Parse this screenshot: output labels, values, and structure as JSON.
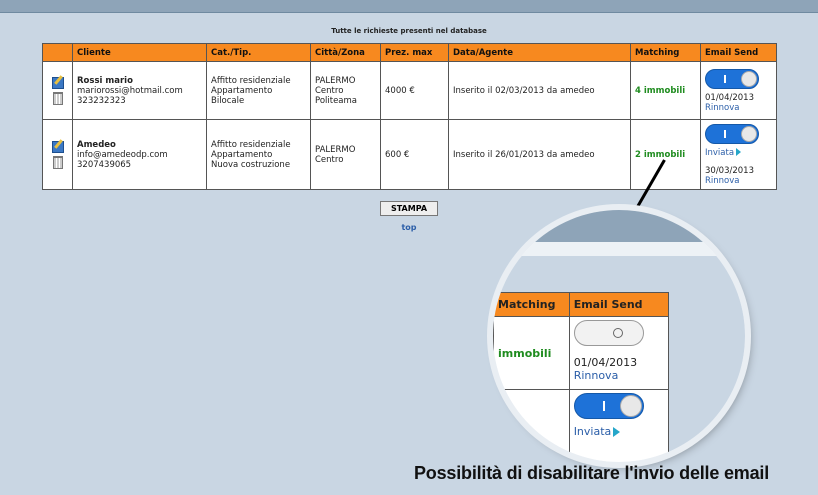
{
  "page": {
    "title": "Tutte le richieste presenti nel database",
    "print_button": "STAMPA",
    "top_link": "top",
    "caption": "Possibilità di disabilitare l'invio delle email"
  },
  "table": {
    "headers": [
      "Cliente",
      "Cat./Tip.",
      "Città/Zona",
      "Prez. max",
      "Data/Agente",
      "Matching",
      "Email Send"
    ],
    "rows": [
      {
        "name": "Rossi mario",
        "email": "mariorossi@hotmail.com",
        "phone": "323232323",
        "cat": [
          "Affitto residenziale",
          "Appartamento",
          "Bilocale"
        ],
        "city": [
          "PALERMO",
          "Centro",
          "Politeama"
        ],
        "price": "4000 €",
        "date_agent": "Inserito il 02/03/2013 da amedeo",
        "matching": "4 immobili",
        "email_send": {
          "date": "01/04/2013",
          "renew": "Rinnova",
          "sent": ""
        }
      },
      {
        "name": "Amedeo",
        "email": "info@amedeodp.com",
        "phone": "3207439065",
        "cat": [
          "Affitto residenziale",
          "Appartamento",
          "Nuova costruzione"
        ],
        "city": [
          "PALERMO",
          "Centro"
        ],
        "price": "600 €",
        "date_agent": "Inserito il 26/01/2013 da amedeo",
        "matching": "2 immobili",
        "email_send": {
          "date": "30/03/2013",
          "renew": "Rinnova",
          "sent": "Inviata"
        }
      }
    ]
  },
  "zoom": {
    "headers": [
      "Matching",
      "Email Send"
    ],
    "row1": {
      "matching": "immobili",
      "date": "01/04/2013",
      "renew": "Rinnova"
    },
    "row2": {
      "sent": "Inviata"
    }
  },
  "colors": {
    "header": "#f7891f",
    "toggle_on": "#1e72d8",
    "matching": "#1f8c1f",
    "link": "#2b5ea8"
  }
}
